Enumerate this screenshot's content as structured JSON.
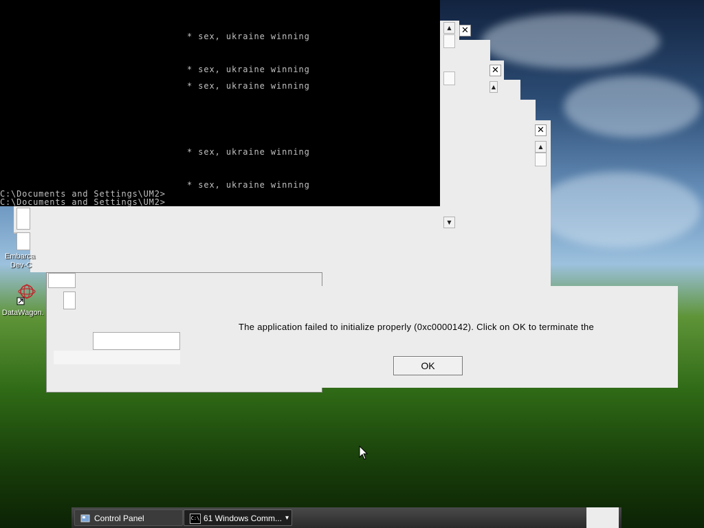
{
  "console": {
    "lines": [
      "* sex, ukraine winning",
      "* sex, ukraine winning",
      "* sex, ukraine winning",
      "* sex, ukraine winning",
      "* sex, ukraine winning"
    ],
    "prompts": [
      "C:\\Documents and Settings\\UM2>",
      "C:\\Documents and Settings\\UM2>"
    ]
  },
  "dialog": {
    "message": "The application failed to initialize properly (0xc0000142). Click on OK to terminate the",
    "ok_label": "OK"
  },
  "ghost_windows": {
    "close_glyph": "✕",
    "scroll_up_glyph": "▲",
    "scroll_down_glyph": "▼"
  },
  "desktop_icons": [
    {
      "label_line1": "Embarca",
      "label_line2": "Dev-C"
    },
    {
      "label": "DataWagon.",
      "icon": "datawagon-icon"
    }
  ],
  "taskbar": {
    "items": [
      {
        "label": "Control Panel",
        "icon": "control-panel-icon"
      },
      {
        "label": "61 Windows Comm...",
        "icon_text": "C:\\",
        "icon": "console-icon"
      }
    ],
    "dropdown_glyph": "▾"
  },
  "colors": {
    "console_bg": "#000000",
    "console_text": "#c0c0c0",
    "dialog_bg": "#ececec",
    "taskbar_bg": "#2f2f2f"
  }
}
